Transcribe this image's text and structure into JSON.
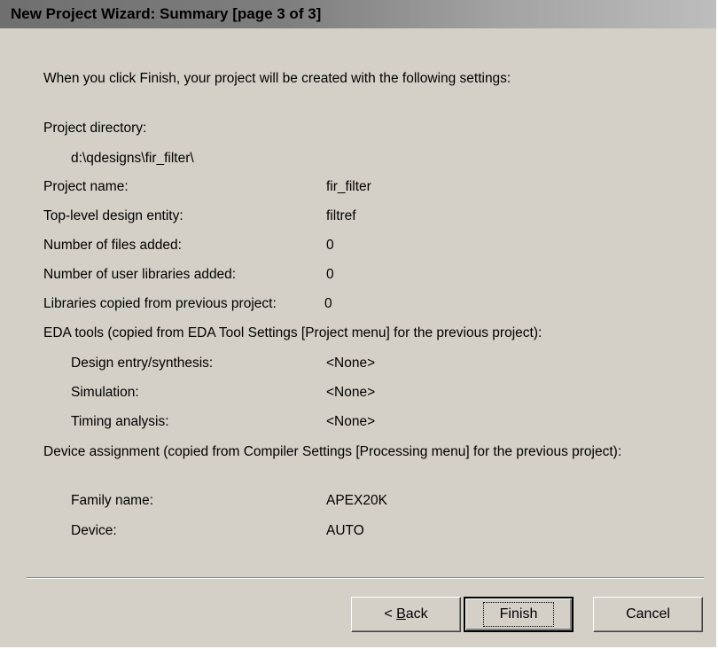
{
  "title": "New Project Wizard: Summary [page 3 of 3]",
  "intro": "When you click Finish, your project will be created with the following settings:",
  "project_directory": {
    "label": "Project directory:",
    "value": "d:\\qdesigns\\fir_filter\\"
  },
  "project_name": {
    "label": "Project name:",
    "value": "fir_filter"
  },
  "top_level_entity": {
    "label": "Top-level design entity:",
    "value": "filtref"
  },
  "files_added": {
    "label": "Number of files added:",
    "value": "0"
  },
  "user_libraries": {
    "label": "Number of user libraries added:",
    "value": "0"
  },
  "libraries_copied": {
    "label": "Libraries copied from previous project:",
    "value": "0"
  },
  "eda_tools": {
    "heading": "EDA tools (copied from EDA Tool Settings [Project menu] for the previous project):",
    "design_entry": {
      "label": "Design entry/synthesis:",
      "value": "<None>"
    },
    "simulation": {
      "label": "Simulation:",
      "value": "<None>"
    },
    "timing": {
      "label": "Timing analysis:",
      "value": "<None>"
    }
  },
  "device_assignment": {
    "heading": "Device assignment (copied from Compiler Settings [Processing menu] for the previous project):",
    "family": {
      "label": "Family name:",
      "value": "APEX20K"
    },
    "device": {
      "label": "Device:",
      "value": "AUTO"
    }
  },
  "buttons": {
    "back_prefix": "< ",
    "back_mnemonic": "B",
    "back_rest": "ack",
    "finish": "Finish",
    "cancel": "Cancel"
  }
}
